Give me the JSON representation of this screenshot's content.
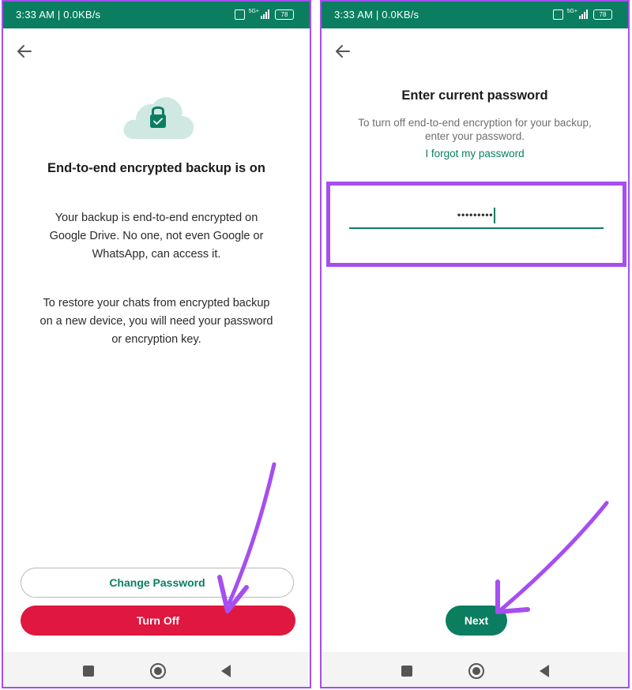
{
  "status_bar": {
    "time": "3:33 AM | 0.0KB/s",
    "network": "5G+",
    "battery": "78"
  },
  "left_screen": {
    "heading": "End-to-end encrypted backup is on",
    "paragraph1": [
      "Your backup is end-to-end encrypted on",
      "Google Drive. No one, not even Google or",
      "WhatsApp, can access it."
    ],
    "paragraph2": [
      "To restore your chats from encrypted backup",
      "on a new device, you will need your password",
      "or encryption key."
    ],
    "change_password_label": "Change Password",
    "turn_off_label": "Turn Off"
  },
  "right_screen": {
    "heading": "Enter current password",
    "subtitle": [
      "To turn off end-to-end encryption for your backup,",
      "enter your password."
    ],
    "forgot_link": "I forgot my password",
    "password_value": "•••••••••",
    "next_label": "Next"
  },
  "colors": {
    "brand_green": "#0b7e61",
    "danger_red": "#e0173f",
    "highlight_purple": "#a64ef0",
    "cloud_mint": "#cfe8e2"
  },
  "icons": [
    "back-arrow-icon",
    "cloud-lock-icon",
    "sim-icon",
    "signal-icon",
    "battery-icon",
    "square-nav-icon",
    "home-nav-icon",
    "back-nav-icon",
    "annotation-arrow-icon"
  ]
}
